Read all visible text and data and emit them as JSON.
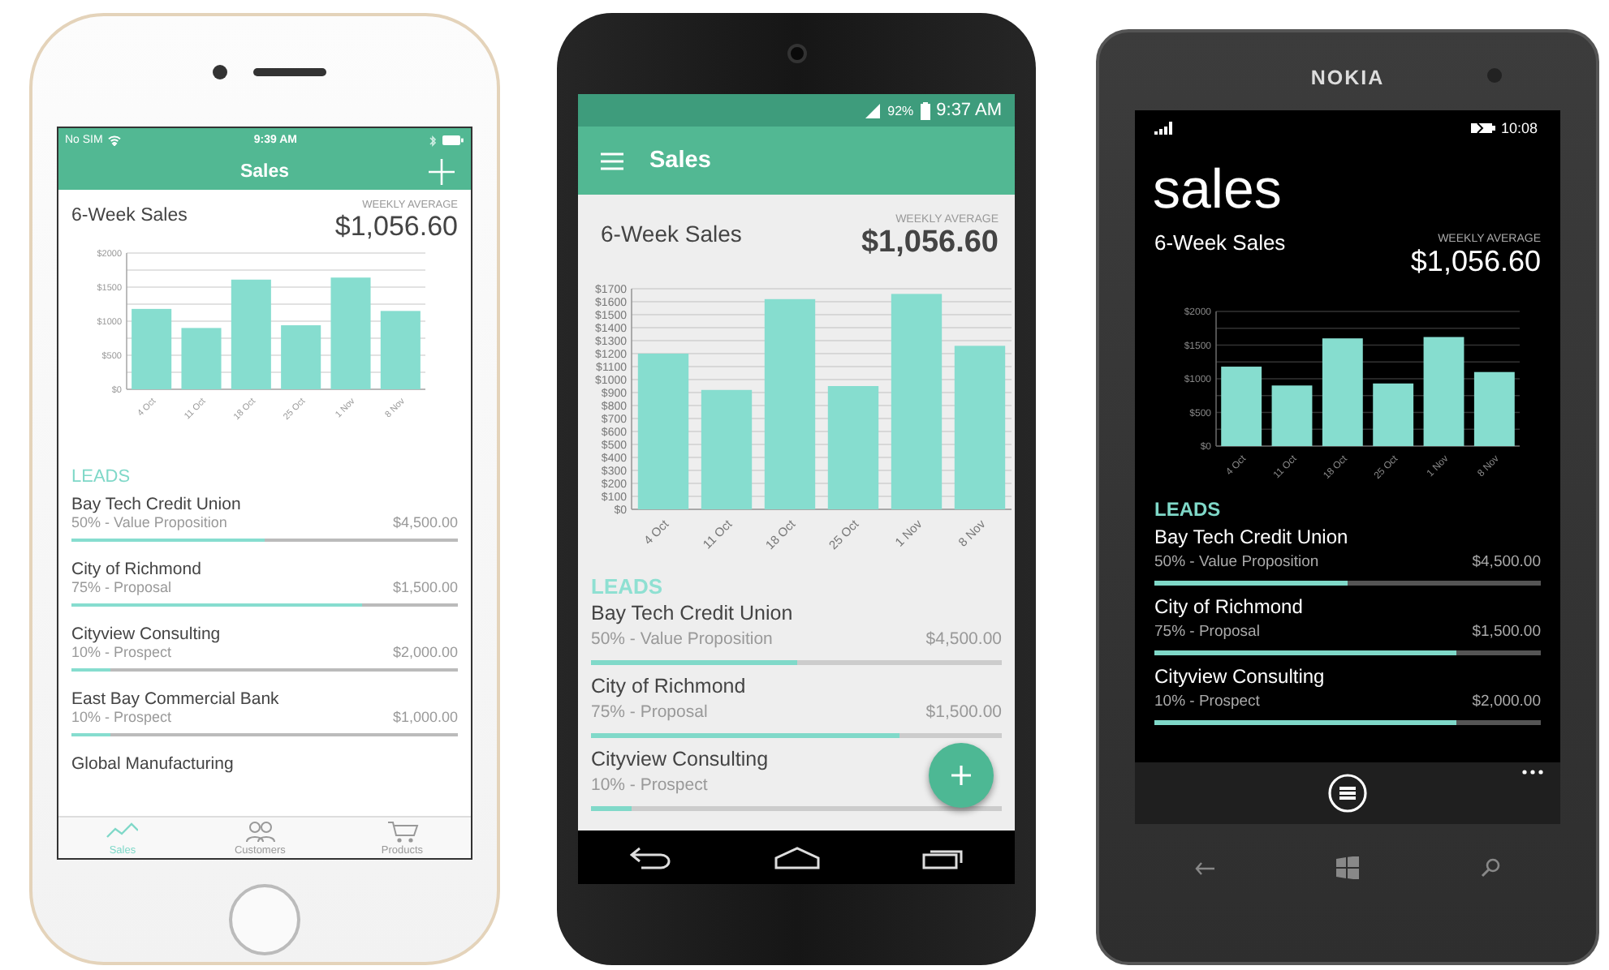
{
  "phones": [
    {
      "kind": "ios",
      "status_bar": {
        "carrier": "No SIM",
        "time": "9:39 AM"
      },
      "title": "Sales",
      "summary": {
        "title": "6-Week Sales",
        "label": "WEEKLY AVERAGE",
        "value": "$1,056.60"
      },
      "chart_data": {
        "type": "bar",
        "categories": [
          "4 Oct",
          "11 Oct",
          "18 Oct",
          "25 Oct",
          "1 Nov",
          "8 Nov"
        ],
        "values": [
          1180,
          900,
          1610,
          940,
          1640,
          1150
        ],
        "grid": true,
        "ylim": [
          0,
          2000
        ],
        "yticks": [
          {
            "value": 0,
            "label": "$0"
          },
          {
            "value": 500,
            "label": "$500"
          },
          {
            "value": 1000,
            "label": "$1000"
          },
          {
            "value": 1500,
            "label": "$1500"
          },
          {
            "value": 2000,
            "label": "$2000"
          }
        ]
      },
      "leads_title": "LEADS",
      "leads": [
        {
          "name": "Bay Tech Credit Union",
          "stage": "50% - Value Proposition",
          "amount": "$4,500.00",
          "level": 0.5
        },
        {
          "name": "City of Richmond",
          "stage": "75% - Proposal",
          "amount": "$1,500.00",
          "level": 0.75
        },
        {
          "name": "Cityview Consulting",
          "stage": "10% - Prospect",
          "amount": "$2,000.00",
          "level": 0.1
        },
        {
          "name": "East Bay Commercial Bank",
          "stage": "10% - Prospect",
          "amount": "$1,000.00",
          "level": 0.1
        },
        {
          "name": "Global Manufacturing"
        }
      ],
      "tabs": [
        {
          "label": "Sales",
          "selected": true
        },
        {
          "label": "Customers",
          "selected": false
        },
        {
          "label": "Products",
          "selected": false
        }
      ]
    },
    {
      "kind": "android",
      "status_bar": {
        "battery": "92%",
        "time": "9:37 AM"
      },
      "title": "Sales",
      "summary": {
        "title": "6-Week Sales",
        "label": "WEEKLY AVERAGE",
        "value": "$1,056.60"
      },
      "chart_data": {
        "type": "bar",
        "categories": [
          "4 Oct",
          "11 Oct",
          "18 Oct",
          "25 Oct",
          "1 Nov",
          "8 Nov"
        ],
        "values": [
          1200,
          920,
          1620,
          950,
          1660,
          1260
        ],
        "grid": true,
        "ylim": [
          0,
          1700
        ],
        "yticks": [
          {
            "value": 0,
            "label": "$0"
          },
          {
            "value": 100,
            "label": "$100"
          },
          {
            "value": 200,
            "label": "$200"
          },
          {
            "value": 300,
            "label": "$300"
          },
          {
            "value": 400,
            "label": "$400"
          },
          {
            "value": 500,
            "label": "$500"
          },
          {
            "value": 600,
            "label": "$600"
          },
          {
            "value": 700,
            "label": "$700"
          },
          {
            "value": 800,
            "label": "$800"
          },
          {
            "value": 900,
            "label": "$900"
          },
          {
            "value": 1000,
            "label": "$1000"
          },
          {
            "value": 1100,
            "label": "$1100"
          },
          {
            "value": 1200,
            "label": "$1200"
          },
          {
            "value": 1300,
            "label": "$1300"
          },
          {
            "value": 1400,
            "label": "$1400"
          },
          {
            "value": 1500,
            "label": "$1500"
          },
          {
            "value": 1600,
            "label": "$1600"
          },
          {
            "value": 1700,
            "label": "$1700"
          }
        ]
      },
      "leads_title": "LEADS",
      "leads": [
        {
          "name": "Bay Tech Credit Union",
          "stage": "50% - Value Proposition",
          "amount": "$4,500.00",
          "level": 0.5
        },
        {
          "name": "City of Richmond",
          "stage": "75% - Proposal",
          "amount": "$1,500.00",
          "level": 0.75
        },
        {
          "name": "Cityview Consulting",
          "stage": "10% - Prospect",
          "level": 0.1
        }
      ]
    },
    {
      "kind": "windows",
      "brand": "NOKIA",
      "status_bar": {
        "time": "10:08"
      },
      "title": "sales",
      "summary": {
        "title": "6-Week Sales",
        "label": "WEEKLY AVERAGE",
        "value": "$1,056.60"
      },
      "chart_data": {
        "type": "bar",
        "categories": [
          "4 Oct",
          "11 Oct",
          "18 Oct",
          "25 Oct",
          "1 Nov",
          "8 Nov"
        ],
        "values": [
          1180,
          900,
          1600,
          930,
          1620,
          1100
        ],
        "grid": true,
        "ylim": [
          0,
          2000
        ],
        "yticks": [
          {
            "value": 0,
            "label": "$0"
          },
          {
            "value": 500,
            "label": "$500"
          },
          {
            "value": 1000,
            "label": "$1000"
          },
          {
            "value": 1500,
            "label": "$1500"
          },
          {
            "value": 2000,
            "label": "$2000"
          }
        ]
      },
      "leads_title": "LEADS",
      "leads": [
        {
          "name": "Bay Tech Credit Union",
          "stage": "50% - Value Proposition",
          "amount": "$4,500.00",
          "level": 0.5
        },
        {
          "name": "City of Richmond",
          "stage": "75% - Proposal",
          "amount": "$1,500.00",
          "level": 0.78
        },
        {
          "name": "Cityview Consulting",
          "stage": "10% - Prospect",
          "amount": "$2,000.00",
          "level": 0.78
        }
      ]
    }
  ]
}
